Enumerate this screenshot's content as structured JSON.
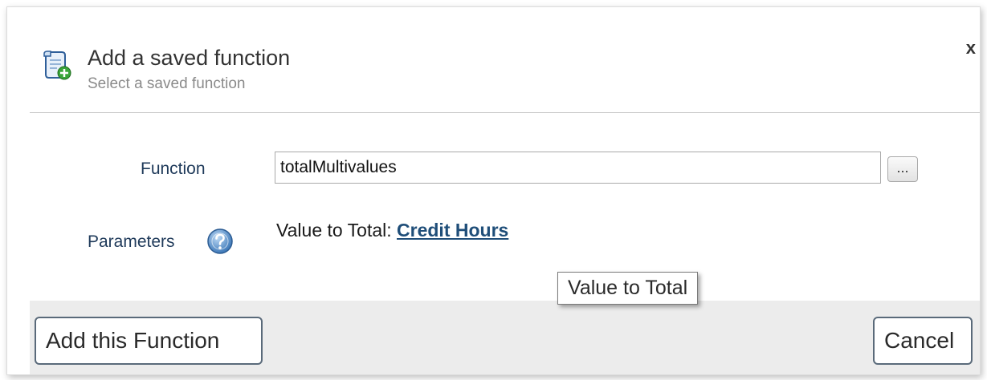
{
  "dialog": {
    "title": "Add a saved function",
    "subtitle": "Select a saved function",
    "close_label": "x",
    "header_icon": "saved-function-add-icon"
  },
  "form": {
    "function_label": "Function",
    "function_value": "totalMultivalues",
    "browse_label": "...",
    "parameters_label": "Parameters",
    "help_icon": "help-icon",
    "param_name": "Value to Total:",
    "param_value": "Credit Hours"
  },
  "tooltip": {
    "text": "Value to Total"
  },
  "footer": {
    "add_label": "Add this Function",
    "cancel_label": "Cancel"
  },
  "colors": {
    "link": "#1f4e79",
    "label": "#1f3a5a",
    "help_icon": "#4a86c5",
    "footer_bg": "#ececec"
  }
}
